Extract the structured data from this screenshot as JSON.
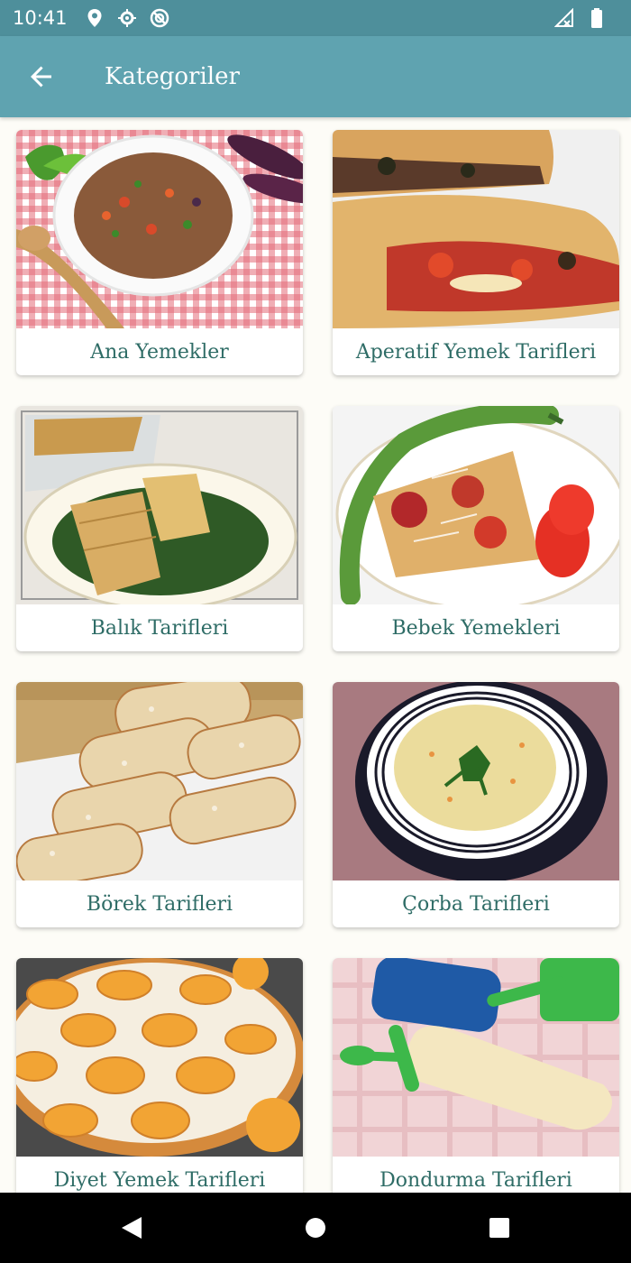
{
  "status_bar": {
    "time": "10:41",
    "icons_left": [
      "location-icon",
      "settings-sync-icon",
      "no-disturb-icon"
    ],
    "icons_right": [
      "signal-icon",
      "battery-icon"
    ]
  },
  "app_bar": {
    "title": "Kategoriler",
    "back_icon": "arrow-back-icon",
    "color": "#5fa3b0"
  },
  "categories": [
    {
      "label": "Ana Yemekler",
      "image": "meat-stew-photo"
    },
    {
      "label": "Aperatif Yemek Tarifleri",
      "image": "calzone-photo"
    },
    {
      "label": "Balık Tarifleri",
      "image": "fish-fillet-photo"
    },
    {
      "label": "Bebek Yemekleri",
      "image": "pizza-with-pepper-photo"
    },
    {
      "label": "Börek Tarifleri",
      "image": "borek-rolls-photo"
    },
    {
      "label": "Çorba Tarifleri",
      "image": "soup-bowl-photo"
    },
    {
      "label": "Diyet Yemek Tarifleri",
      "image": "apricot-tart-photo"
    },
    {
      "label": "Dondurma Tarifleri",
      "image": "ice-pop-photo"
    }
  ],
  "nav_bar": {
    "buttons": [
      "back-triangle-icon",
      "home-circle-icon",
      "recents-square-icon"
    ]
  },
  "colors": {
    "status_bar": "#4e8f9b",
    "label_text": "#2e6c66",
    "page_background": "#fdfcf7"
  }
}
